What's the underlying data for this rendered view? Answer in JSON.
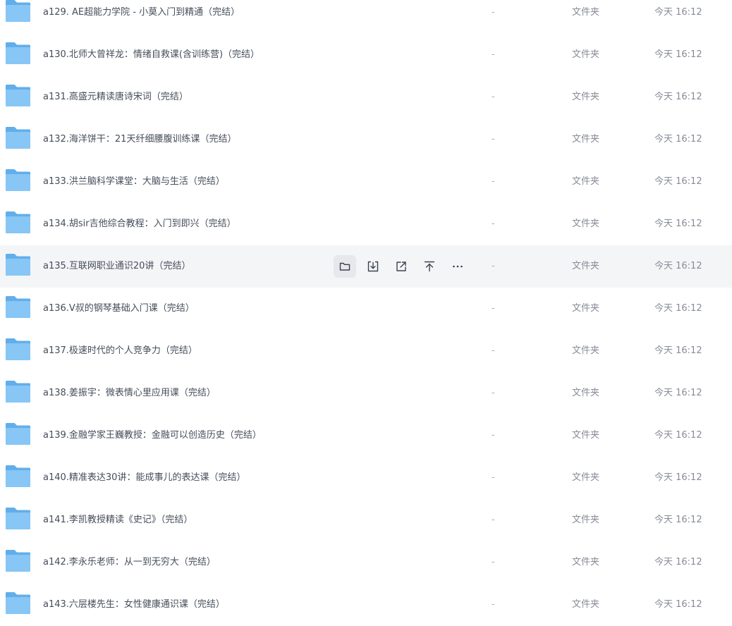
{
  "files": [
    {
      "name": "a129. AE超能力学院 - 小莫入门到精通（完结）",
      "size": "-",
      "type": "文件夹",
      "modified": "今天 16:12"
    },
    {
      "name": "a130.北师大曾祥龙：情绪自救课(含训练营)（完结）",
      "size": "-",
      "type": "文件夹",
      "modified": "今天 16:12"
    },
    {
      "name": "a131.高盛元精读唐诗宋词（完结）",
      "size": "-",
      "type": "文件夹",
      "modified": "今天 16:12"
    },
    {
      "name": "a132.海洋饼干：21天纤细腰腹训练课（完结）",
      "size": "-",
      "type": "文件夹",
      "modified": "今天 16:12"
    },
    {
      "name": "a133.洪兰脑科学课堂：大脑与生活（完结）",
      "size": "-",
      "type": "文件夹",
      "modified": "今天 16:12"
    },
    {
      "name": "a134.胡sir吉他综合教程：入门到即兴（完结）",
      "size": "-",
      "type": "文件夹",
      "modified": "今天 16:12"
    },
    {
      "name": "a135.互联网职业通识20讲（完结）",
      "size": "-",
      "type": "文件夹",
      "modified": "今天 16:12"
    },
    {
      "name": "a136.V叔的钢琴基础入门课（完结）",
      "size": "-",
      "type": "文件夹",
      "modified": "今天 16:12"
    },
    {
      "name": "a137.极速时代的个人竞争力（完结）",
      "size": "-",
      "type": "文件夹",
      "modified": "今天 16:12"
    },
    {
      "name": "a138.姜振宇：微表情心里应用课（完结）",
      "size": "-",
      "type": "文件夹",
      "modified": "今天 16:12"
    },
    {
      "name": "a139.金融学家王巍教授：金融可以创造历史（完结）",
      "size": "-",
      "type": "文件夹",
      "modified": "今天 16:12"
    },
    {
      "name": "a140.精准表达30讲：能成事儿的表达课（完结）",
      "size": "-",
      "type": "文件夹",
      "modified": "今天 16:12"
    },
    {
      "name": "a141.李凯教授精读《史记》（完结）",
      "size": "-",
      "type": "文件夹",
      "modified": "今天 16:12"
    },
    {
      "name": "a142.李永乐老师：从一到无穷大（完结）",
      "size": "-",
      "type": "文件夹",
      "modified": "今天 16:12"
    },
    {
      "name": "a143.六层楼先生：女性健康通识课（完结）",
      "size": "-",
      "type": "文件夹",
      "modified": "今天 16:12"
    }
  ],
  "hover_row": 6,
  "row_actions": [
    {
      "icon": "open-folder-icon",
      "active": true
    },
    {
      "icon": "download-icon",
      "active": false
    },
    {
      "icon": "share-icon",
      "active": false
    },
    {
      "icon": "pin-top-icon",
      "active": false
    },
    {
      "icon": "more-icon",
      "active": false
    }
  ],
  "colors": {
    "folder_back": "#62aeea",
    "folder_front": "#87c6f5",
    "hover_background": "#f4f5f7",
    "text": "#454d5a",
    "muted_text": "#878c96"
  }
}
